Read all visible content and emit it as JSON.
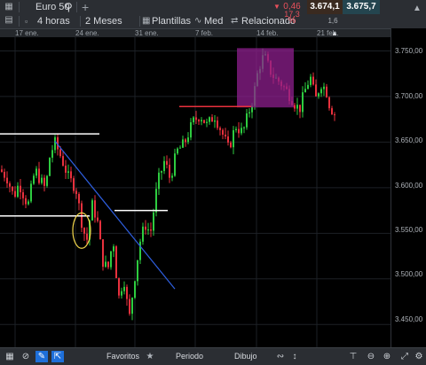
{
  "toolbar": {
    "instrument": "Euro 50",
    "search_icon": "search-icon",
    "add_icon": "plus-icon",
    "timeframe": "4 horas",
    "range": "2 Meses",
    "templates": "Plantillas",
    "indicator": "Med",
    "related": "Relacionado",
    "change_pct": "0,46 %",
    "change_abs": "17,3",
    "sell_price": "3.674,1",
    "spread": "1,6",
    "buy_price": "3.675,7",
    "colors": {
      "down": "#e8505b",
      "sell_bg": "#3a2a20",
      "buy_bg": "#24454f"
    }
  },
  "dates": [
    "17 ene.",
    "24 ene.",
    "31 ene.",
    "7 feb.",
    "14 feb.",
    "21 feb."
  ],
  "price_axis": [
    "3.750,00",
    "3.700,00",
    "3.650,00",
    "3.600,00",
    "3.550,00",
    "3.500,00",
    "3.450,00"
  ],
  "bottom": {
    "favorites": "Favoritos",
    "period": "Periodo",
    "drawing": "Dibujo"
  },
  "chart_data": {
    "type": "candlestick",
    "xlabel": "",
    "ylabel": "",
    "ylim": [
      3425,
      3765
    ],
    "x_ticks": [
      "17 ene.",
      "24 ene.",
      "31 ene.",
      "7 feb.",
      "14 feb.",
      "21 feb."
    ],
    "y_ticks": [
      3750,
      3700,
      3650,
      3600,
      3550,
      3500,
      3450
    ],
    "colors": {
      "up": "#2ecc40",
      "down": "#e8313d",
      "grid": "#1d2126"
    },
    "annotations": {
      "support_lines": [
        3659,
        3569,
        3575,
        3689
      ],
      "trendline": "descending blue line from 24 ene. to 31 ene.",
      "highlight_box": "magenta rectangle around the 14 feb. top",
      "ellipse": "yellow ellipse on the 24 ene. low"
    }
  }
}
